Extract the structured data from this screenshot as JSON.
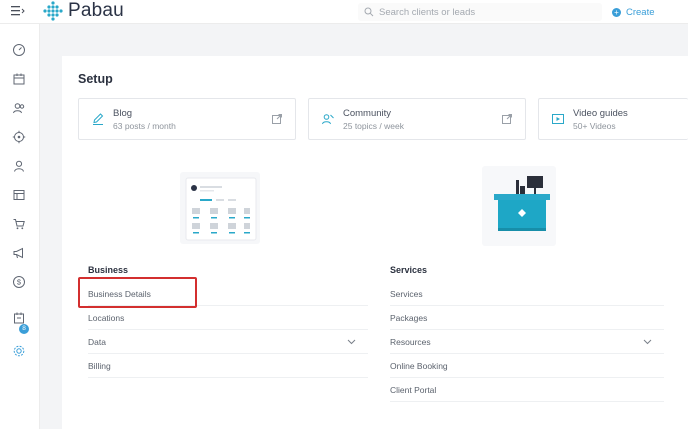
{
  "header": {
    "logo_text": "Pabau",
    "search_placeholder": "Search clients or leads",
    "create_label": "Create"
  },
  "sidebar": {
    "items": [
      {
        "icon": "dashboard-icon"
      },
      {
        "icon": "calendar-icon"
      },
      {
        "icon": "clients-icon"
      },
      {
        "icon": "leads-icon"
      },
      {
        "icon": "user-icon"
      },
      {
        "icon": "catalog-icon"
      },
      {
        "icon": "cart-icon"
      },
      {
        "icon": "megaphone-icon"
      },
      {
        "icon": "dollar-icon"
      },
      {
        "icon": "tasks-icon"
      },
      {
        "icon": "gear-icon"
      }
    ],
    "badge_count": "8"
  },
  "page": {
    "title": "Setup"
  },
  "cards": [
    {
      "title": "Blog",
      "subtitle": "63 posts / month",
      "icon": "pencil-icon"
    },
    {
      "title": "Community",
      "subtitle": "25 topics / week",
      "icon": "community-icon"
    },
    {
      "title": "Video guides",
      "subtitle": "50+ Videos",
      "icon": "video-icon"
    }
  ],
  "sections": {
    "business": {
      "title": "Business",
      "items": [
        "Business Details",
        "Locations",
        "Data",
        "Billing"
      ]
    },
    "services": {
      "title": "Services",
      "items": [
        "Services",
        "Packages",
        "Resources",
        "Online Booking",
        "Client Portal"
      ]
    }
  },
  "colors": {
    "accent": "#3a9ed8",
    "highlight": "#d32f2f",
    "teal": "#1ea7c6"
  }
}
